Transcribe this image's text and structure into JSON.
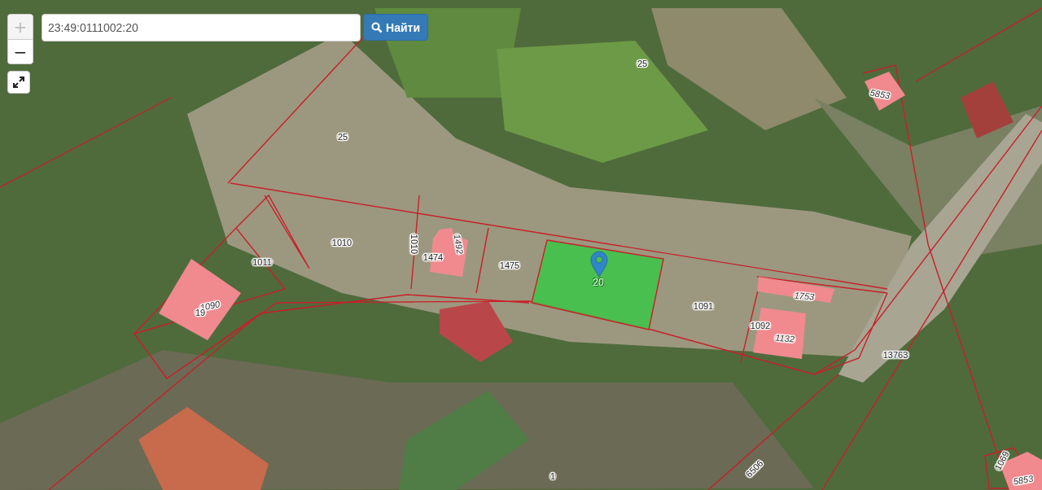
{
  "search": {
    "value": "23:49:0111002:20",
    "button": "Найти"
  },
  "zoom": [
    {
      "label": "+",
      "disabled": true
    },
    {
      "label": "−",
      "disabled": false
    }
  ],
  "parcel_labels": [
    {
      "text": "25",
      "kind": "parcel"
    },
    {
      "text": "25",
      "kind": "parcel"
    },
    {
      "text": "1010",
      "kind": "parcel"
    },
    {
      "text": "1010",
      "kind": "parcel"
    },
    {
      "text": "1011",
      "kind": "parcel"
    },
    {
      "text": "1474",
      "kind": "parcel"
    },
    {
      "text": "1492",
      "kind": "building"
    },
    {
      "text": "1475",
      "kind": "parcel"
    },
    {
      "text": "20",
      "kind": "selected"
    },
    {
      "text": "1091",
      "kind": "parcel"
    },
    {
      "text": "1753",
      "kind": "building"
    },
    {
      "text": "1092",
      "kind": "parcel"
    },
    {
      "text": "1132",
      "kind": "building"
    },
    {
      "text": "13763",
      "kind": "parcel"
    },
    {
      "text": "1090",
      "kind": "building"
    },
    {
      "text": "19",
      "kind": "parcel"
    },
    {
      "text": "5853",
      "kind": "building"
    },
    {
      "text": "6506",
      "kind": "parcel"
    },
    {
      "text": "1",
      "kind": "parcel"
    },
    {
      "text": "1069",
      "kind": "parcel"
    },
    {
      "text": "5853",
      "kind": "building"
    }
  ]
}
